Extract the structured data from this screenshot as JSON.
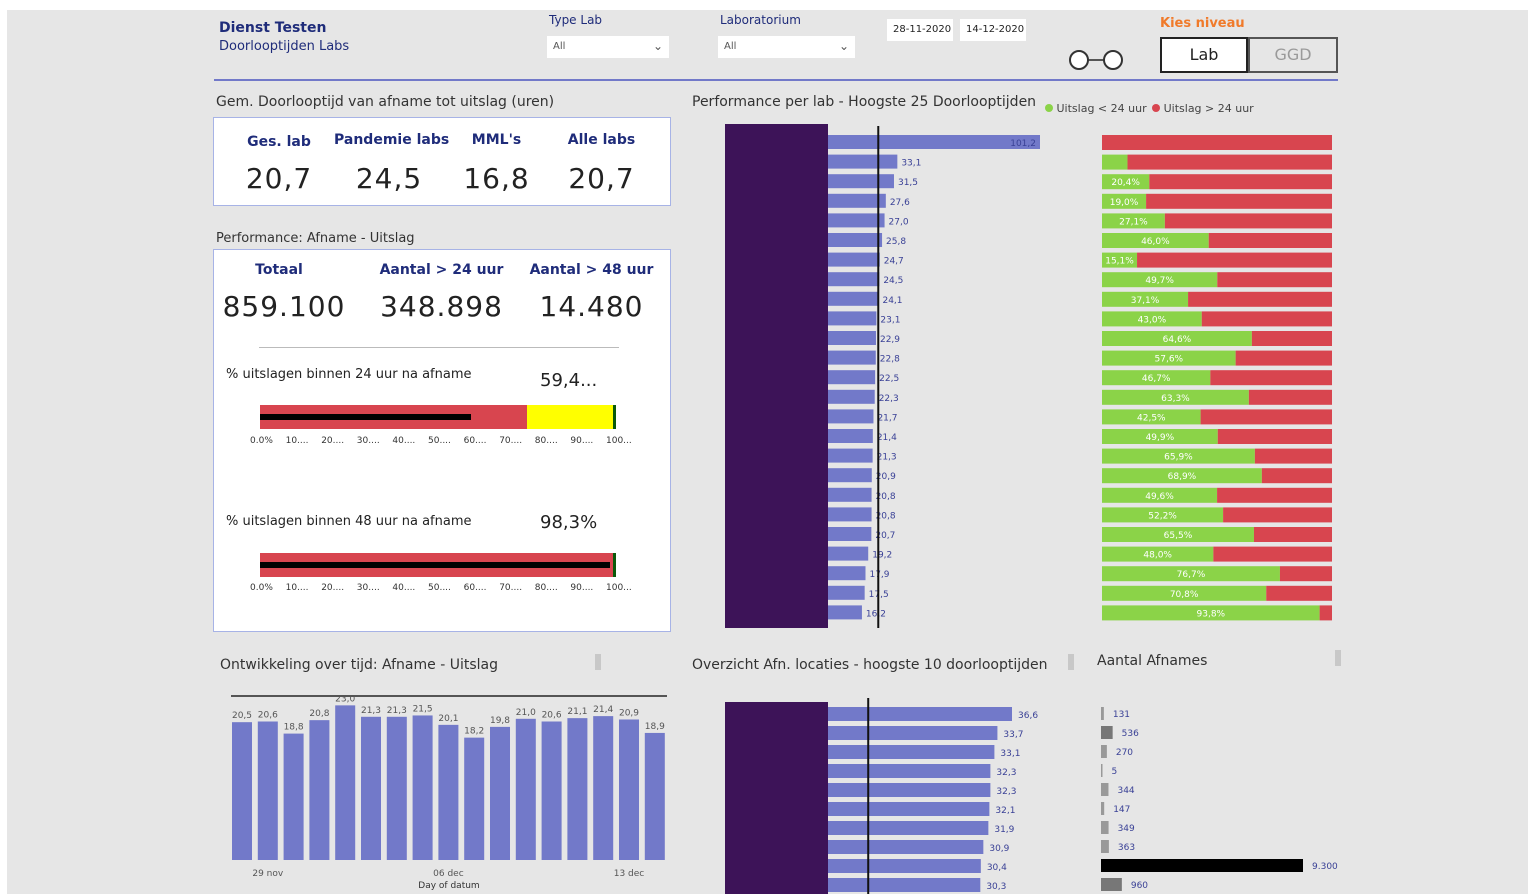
{
  "header": {
    "title": "Dienst Testen",
    "subtitle": "Doorlooptijden Labs",
    "filter_type_lab": {
      "label": "Type Lab",
      "value": "All"
    },
    "filter_lab": {
      "label": "Laboratorium",
      "value": "All"
    },
    "date_from": "28-11-2020",
    "date_to": "14-12-2020",
    "level": {
      "label": "Kies niveau",
      "options": [
        "Lab",
        "GGD"
      ],
      "selected": "Lab"
    }
  },
  "kpi_gem": {
    "title": "Gem. Doorlooptijd van afname tot uitslag (uren)",
    "items": [
      {
        "label": "Ges. lab",
        "value": "20,7"
      },
      {
        "label": "Pandemie labs",
        "value": "24,5"
      },
      {
        "label": "MML's",
        "value": "16,8"
      },
      {
        "label": "Alle labs",
        "value": "20,7"
      }
    ]
  },
  "performance": {
    "title": "Performance: Afname - Uitslag",
    "items": [
      {
        "label": "Totaal",
        "value": "859.100"
      },
      {
        "label": "Aantal > 24 uur",
        "value": "348.898"
      },
      {
        "label": "Aantal > 48 uur",
        "value": "14.480"
      }
    ],
    "gauge24": {
      "label": "% uitslagen binnen 24 uur na afname",
      "value_text": "59,4...",
      "value": 59.4,
      "bands": [
        75,
        100
      ],
      "target": 100
    },
    "gauge48": {
      "label": "% uitslagen binnen 48 uur na afname",
      "value_text": "98,3%",
      "value": 98.3,
      "bands": [
        100,
        100
      ],
      "target": 100
    },
    "ticks": [
      "0.0%",
      "10....",
      "20....",
      "30....",
      "40....",
      "50....",
      "60....",
      "70....",
      "80....",
      "90....",
      "100..."
    ]
  },
  "colors": {
    "bar": "#7279c9",
    "purple": "#3d1358",
    "green": "#8bd348",
    "red": "#d8454f",
    "yellow": "#ffff00",
    "orange": "#f07a2a",
    "navy": "#1f2c7a"
  },
  "chart_data": [
    {
      "type": "bar",
      "title": "Performance per lab - Hoogste 25 Doorlooptijden",
      "orientation": "horizontal",
      "values": [
        101.2,
        33.1,
        31.5,
        27.6,
        27.0,
        25.8,
        24.7,
        24.5,
        24.1,
        23.1,
        22.9,
        22.8,
        22.5,
        22.3,
        21.7,
        21.4,
        21.3,
        20.9,
        20.8,
        20.8,
        20.7,
        19.2,
        17.9,
        17.5,
        16.2
      ],
      "labels": [
        "101,2",
        "33,1",
        "31,5",
        "27,6",
        "27,0",
        "25,8",
        "24,7",
        "24,5",
        "24,1",
        "23,1",
        "22,9",
        "22,8",
        "22,5",
        "22,3",
        "21,7",
        "21,4",
        "21,3",
        "20,9",
        "20,8",
        "20,8",
        "20,7",
        "19,2",
        "17,9",
        "17,5",
        "16,2"
      ],
      "reference_line": 24
    },
    {
      "type": "bar",
      "stacked": true,
      "legend": [
        "Uitslag < 24 uur",
        "Uitslag > 24 uur"
      ],
      "legend_position": "top",
      "pct_under_24": [
        0,
        11.0,
        20.4,
        19.0,
        27.1,
        46.0,
        15.1,
        49.7,
        37.1,
        43.0,
        64.6,
        57.6,
        46.7,
        63.3,
        42.5,
        49.9,
        65.9,
        68.9,
        49.6,
        52.2,
        65.5,
        48.0,
        76.7,
        70.8,
        93.8
      ],
      "labels": [
        "",
        "",
        "20,4%",
        "19,0%",
        "27,1%",
        "46,0%",
        "15,1%",
        "49,7%",
        "37,1%",
        "43,0%",
        "64,6%",
        "57,6%",
        "46,7%",
        "63,3%",
        "42,5%",
        "49,9%",
        "65,9%",
        "68,9%",
        "49,6%",
        "52,2%",
        "65,5%",
        "48,0%",
        "76,7%",
        "70,8%",
        "93,8%"
      ]
    },
    {
      "type": "bar",
      "title": "Ontwikkeling over tijd: Afname - Uitslag",
      "xlabel": "Day of datum",
      "values": [
        20.5,
        20.6,
        18.8,
        20.8,
        23.0,
        21.3,
        21.3,
        21.5,
        20.1,
        18.2,
        19.8,
        21.0,
        20.6,
        21.1,
        21.4,
        20.9,
        18.9
      ],
      "labels": [
        "20,5",
        "20,6",
        "18,8",
        "20,8",
        "23,0",
        "21,3",
        "21,3",
        "21,5",
        "20,1",
        "18,2",
        "19,8",
        "21,0",
        "20,6",
        "21,1",
        "21,4",
        "20,9",
        "18,9"
      ],
      "xticks": [
        {
          "index": 1,
          "label": "29 nov"
        },
        {
          "index": 8,
          "label": "06 dec"
        },
        {
          "index": 15,
          "label": "13 dec"
        }
      ],
      "ylim": [
        0,
        23.5
      ]
    },
    {
      "type": "bar",
      "title": "Overzicht Afn. locaties - hoogste 10 doorlooptijden",
      "orientation": "horizontal",
      "values": [
        36.6,
        33.7,
        33.1,
        32.3,
        32.3,
        32.1,
        31.9,
        30.9,
        30.4,
        30.3
      ],
      "labels": [
        "36,6",
        "33,7",
        "33,1",
        "32,3",
        "32,3",
        "32,1",
        "31,9",
        "30,9",
        "30,4",
        "30,3"
      ],
      "reference_line": 8
    },
    {
      "type": "bar",
      "title": "Aantal Afnames",
      "orientation": "horizontal",
      "values": [
        131,
        536,
        270,
        5,
        344,
        147,
        349,
        363,
        9300,
        960
      ],
      "labels": [
        "131",
        "536",
        "270",
        "5",
        "344",
        "147",
        "349",
        "363",
        "9.300",
        "960"
      ]
    }
  ]
}
